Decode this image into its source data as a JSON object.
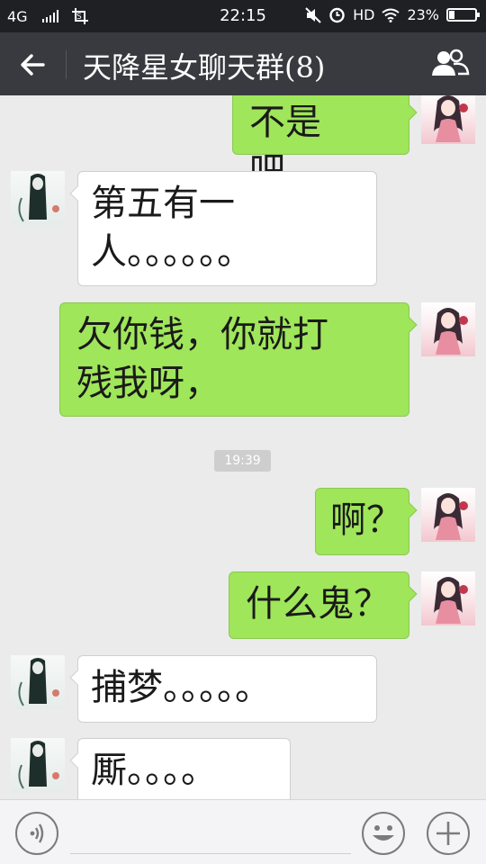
{
  "status_bar": {
    "network": "4G",
    "time": "22:15",
    "hd_label": "HD",
    "battery_text": "23%",
    "battery_level": 0.23,
    "icons": [
      "signal-icon",
      "screenshot-icon",
      "mute-icon",
      "alarm-icon",
      "wifi-icon",
      "battery-icon"
    ]
  },
  "header": {
    "title": "天降星女聊天群(8)",
    "back_icon": "back-arrow-icon",
    "members_icon": "group-members-icon"
  },
  "chat": {
    "timestamp": "19:39",
    "messages": [
      {
        "sender": "me",
        "text": "不是吧。"
      },
      {
        "sender": "other",
        "text": "第五有一\n人。。。。。。"
      },
      {
        "sender": "me",
        "text": "欠你钱，你就打\n残我呀，"
      },
      {
        "sender": "me",
        "text": "啊？"
      },
      {
        "sender": "me",
        "text": "什么鬼？"
      },
      {
        "sender": "other",
        "text": "捕梦。。。。。"
      },
      {
        "sender": "other",
        "text": "厮。。。。"
      }
    ]
  },
  "input_bar": {
    "placeholder": "",
    "icons": [
      "voice-icon",
      "emoji-icon",
      "plus-icon"
    ]
  },
  "colors": {
    "status_bar_bg": "#1e2024",
    "nav_bg": "#393a3f",
    "chat_bg": "#ebebeb",
    "bubble_me": "#9fe65a",
    "bubble_other": "#ffffff"
  }
}
